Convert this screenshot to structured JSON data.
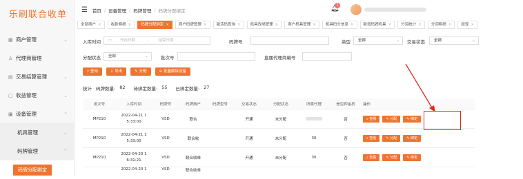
{
  "sidebar": {
    "logo": "乐刷联合收单",
    "items": [
      {
        "label": "商户管理",
        "icon": "grid-icon"
      },
      {
        "label": "代理商管理",
        "icon": "person-icon"
      },
      {
        "label": "交易结算管理",
        "icon": "list-icon"
      },
      {
        "label": "收益管理",
        "icon": "wallet-icon"
      },
      {
        "label": "设备管理",
        "icon": "device-icon"
      }
    ],
    "subitems": [
      {
        "label": "机具管理"
      },
      {
        "label": "码牌管理"
      },
      {
        "label": "码牌分配绑定"
      }
    ]
  },
  "topbar": {
    "breadcrumb": [
      "首页",
      "设备管理",
      "码牌管理",
      "码牌分配绑定"
    ],
    "badge": "1"
  },
  "tabs": [
    {
      "label": "全部商户"
    },
    {
      "label": "收款明细"
    },
    {
      "label": "码牌分配绑定"
    },
    {
      "label": "商户码牌管理"
    },
    {
      "label": "激活码查询"
    },
    {
      "label": "机具改绑管理"
    },
    {
      "label": "商户机具管理"
    },
    {
      "label": "机具码分信息"
    },
    {
      "label": "新增码牌机具"
    },
    {
      "label": "分润统计"
    },
    {
      "label": "分润明细"
    },
    {
      "label": "提现"
    }
  ],
  "filters": {
    "storage_time_label": "入库时间",
    "start_placeholder": "开始日期",
    "sep": "-",
    "end_placeholder": "结束日期",
    "code_no_label": "码牌号",
    "type_label": "类型",
    "type_value": "全部",
    "trade_status_label": "交易状态",
    "trade_status_value": "全部",
    "assign_status_label": "分配状态",
    "assign_status_value": "全部",
    "batch_label": "批次号",
    "agent_label": "直属代理商编号"
  },
  "buttons": [
    {
      "label": "查询"
    },
    {
      "label": "导出"
    },
    {
      "label": "分配"
    },
    {
      "label": "批量解除设备"
    }
  ],
  "stats": {
    "title": "统计",
    "code_count_label": "码牌数量:",
    "code_count": "82",
    "pending_label": "待绑定数量:",
    "pending": "55",
    "bound_label": "已绑定数量:",
    "bound": "27"
  },
  "table": {
    "headers": [
      "批次号",
      "入库时间",
      "码牌号",
      "码牌商户",
      "码牌型号",
      "交易状态",
      "分配状态",
      "所属代理",
      "是否押金机",
      "操作"
    ],
    "rows": [
      {
        "batch": "MP210",
        "time1": "2022-04-21 1",
        "time2": "5:33:00",
        "code": "VSD",
        "merchant": "联合",
        "trade": "开通",
        "assign": "未分配",
        "agent": "",
        "deposit": "否"
      },
      {
        "batch": "MP210",
        "time1": "2022-04-21 1",
        "time2": "5:33:00",
        "code": "VSD",
        "merchant": "联合收",
        "trade": "开通",
        "assign": "未分配",
        "agent": "30",
        "deposit": "否"
      },
      {
        "batch": "MP210",
        "time1": "2022-04-20 1",
        "time2": "6:31:21",
        "code": "VSD",
        "merchant": "联合收单",
        "trade": "开通",
        "assign": "未分配",
        "agent": "30",
        "deposit": "否"
      },
      {
        "batch": "",
        "time1": "2022-04-20 1",
        "time2": "",
        "code": "VSD",
        "merchant": "联合收单",
        "trade": "",
        "assign": "",
        "agent": "",
        "deposit": ""
      }
    ],
    "actions": [
      "查看",
      "分配",
      "绑定"
    ]
  },
  "colors": {
    "accent": "#ee7430",
    "highlight": "#e0281e"
  }
}
